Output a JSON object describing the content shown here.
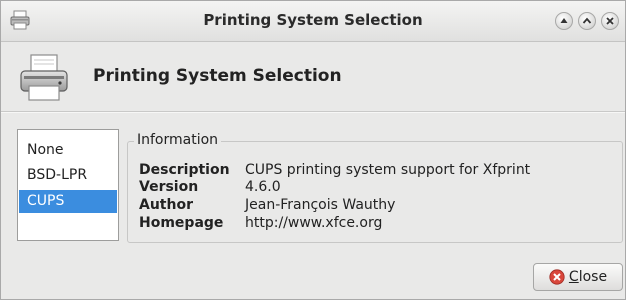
{
  "window": {
    "title": "Printing System Selection"
  },
  "header": {
    "heading": "Printing System Selection",
    "icon": "printer-icon"
  },
  "list": {
    "items": [
      {
        "label": "None",
        "selected": false
      },
      {
        "label": "BSD-LPR",
        "selected": false
      },
      {
        "label": "CUPS",
        "selected": true
      }
    ]
  },
  "info": {
    "legend": "Information",
    "rows": [
      {
        "key": "Description",
        "value": "CUPS printing system support for Xfprint"
      },
      {
        "key": "Version",
        "value": "4.6.0"
      },
      {
        "key": "Author",
        "value": "Jean-François Wauthy"
      },
      {
        "key": "Homepage",
        "value": "http://www.xfce.org"
      }
    ]
  },
  "buttons": {
    "close_mnemonic": "C",
    "close_rest": "lose",
    "close_icon": "close-circle-icon"
  },
  "colors": {
    "selection": "#3b8ddf",
    "close_icon": "#d9463b"
  }
}
